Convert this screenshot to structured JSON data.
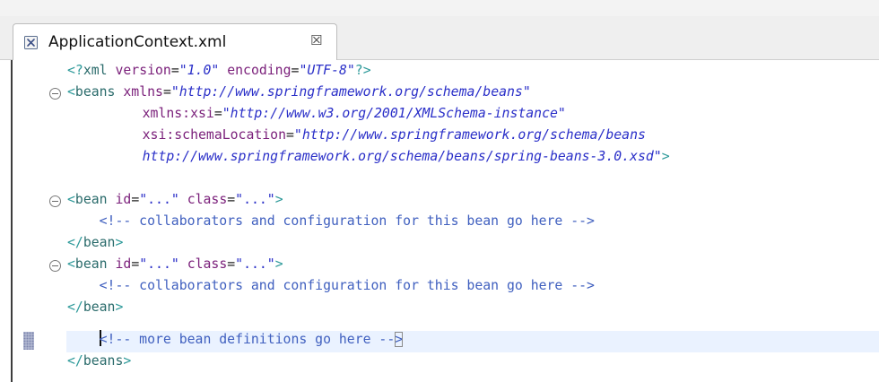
{
  "tab": {
    "file_icon": "xml-file-icon",
    "title": "ApplicationContext.xml",
    "close_symbol": "☒",
    "close_icon": "close-icon"
  },
  "editor": {
    "fold_icon": "fold-collapse-icon",
    "lines": [
      {
        "tokens": [
          {
            "t": "<?",
            "c": "t-punct"
          },
          {
            "t": "xml",
            "c": "t-tag"
          },
          {
            "t": " ",
            "c": "t-plain"
          },
          {
            "t": "version",
            "c": "t-attr"
          },
          {
            "t": "=",
            "c": "t-eq"
          },
          {
            "t": "\"1.0\"",
            "c": "t-val"
          },
          {
            "t": " ",
            "c": "t-plain"
          },
          {
            "t": "encoding",
            "c": "t-attr"
          },
          {
            "t": "=",
            "c": "t-eq"
          },
          {
            "t": "\"UTF-8\"",
            "c": "t-val"
          },
          {
            "t": "?>",
            "c": "t-punct"
          }
        ]
      },
      {
        "tokens": [
          {
            "t": "<",
            "c": "t-punct"
          },
          {
            "t": "beans",
            "c": "t-tag"
          },
          {
            "t": " ",
            "c": "t-plain"
          },
          {
            "t": "xmlns",
            "c": "t-attr"
          },
          {
            "t": "=",
            "c": "t-eq"
          },
          {
            "t": "\"http://www.springframework.org/schema/beans\"",
            "c": "t-val"
          }
        ]
      },
      {
        "tokens": [
          {
            "t": "    ",
            "c": "t-plain"
          },
          {
            "t": "xmlns:xsi",
            "c": "t-attr"
          },
          {
            "t": "=",
            "c": "t-eq"
          },
          {
            "t": "\"http://www.w3.org/2001/XMLSchema-instance\"",
            "c": "t-val"
          }
        ]
      },
      {
        "tokens": [
          {
            "t": "    ",
            "c": "t-plain"
          },
          {
            "t": "xsi:schemaLocation",
            "c": "t-attr"
          },
          {
            "t": "=",
            "c": "t-eq"
          },
          {
            "t": "\"http://www.springframework.org/schema/beans",
            "c": "t-val"
          }
        ]
      },
      {
        "tokens": [
          {
            "t": "    ",
            "c": "t-plain"
          },
          {
            "t": "http://www.springframework.org/schema/beans/spring-beans-3.0.xsd\"",
            "c": "t-val"
          },
          {
            "t": ">",
            "c": "t-punct"
          }
        ]
      },
      {
        "tokens": [
          {
            "t": "<",
            "c": "t-punct"
          },
          {
            "t": "bean",
            "c": "t-tag"
          },
          {
            "t": " ",
            "c": "t-plain"
          },
          {
            "t": "id",
            "c": "t-attr"
          },
          {
            "t": "=",
            "c": "t-eq"
          },
          {
            "t": "\"...\"",
            "c": "t-val-plain"
          },
          {
            "t": " ",
            "c": "t-plain"
          },
          {
            "t": "class",
            "c": "t-attr"
          },
          {
            "t": "=",
            "c": "t-eq"
          },
          {
            "t": "\"...\"",
            "c": "t-val-plain"
          },
          {
            "t": ">",
            "c": "t-punct"
          }
        ]
      },
      {
        "tokens": [
          {
            "t": "    <!-- collaborators and configuration for this bean go here -->",
            "c": "t-cmt"
          }
        ]
      },
      {
        "tokens": [
          {
            "t": "</",
            "c": "t-punct"
          },
          {
            "t": "bean",
            "c": "t-tag"
          },
          {
            "t": ">",
            "c": "t-punct"
          }
        ]
      },
      {
        "tokens": [
          {
            "t": "<",
            "c": "t-punct"
          },
          {
            "t": "bean",
            "c": "t-tag"
          },
          {
            "t": " ",
            "c": "t-plain"
          },
          {
            "t": "id",
            "c": "t-attr"
          },
          {
            "t": "=",
            "c": "t-eq"
          },
          {
            "t": "\"...\"",
            "c": "t-val-plain"
          },
          {
            "t": " ",
            "c": "t-plain"
          },
          {
            "t": "class",
            "c": "t-attr"
          },
          {
            "t": "=",
            "c": "t-eq"
          },
          {
            "t": "\"...\"",
            "c": "t-val-plain"
          },
          {
            "t": ">",
            "c": "t-punct"
          }
        ]
      },
      {
        "tokens": [
          {
            "t": "    <!-- collaborators and configuration for this bean go here -->",
            "c": "t-cmt"
          }
        ]
      },
      {
        "tokens": [
          {
            "t": "</",
            "c": "t-punct"
          },
          {
            "t": "bean",
            "c": "t-tag"
          },
          {
            "t": ">",
            "c": "t-punct"
          }
        ]
      },
      {
        "tokens": [
          {
            "t": "    ",
            "c": "t-plain"
          },
          {
            "t": "<!-- more bean definitions go here --",
            "c": "t-cmt"
          },
          {
            "t": ">",
            "c": "t-cmt"
          }
        ]
      },
      {
        "tokens": [
          {
            "t": "</",
            "c": "t-punct"
          },
          {
            "t": "beans",
            "c": "t-tag"
          },
          {
            "t": ">",
            "c": "t-punct"
          }
        ]
      }
    ]
  },
  "colors": {
    "tag_punct": "#2e9a9a",
    "tag_name": "#2a6b6b",
    "attribute": "#7a1f7a",
    "value": "#2a2fc8",
    "comment": "#3f5fbf",
    "current_line": "#eaf2ff"
  }
}
